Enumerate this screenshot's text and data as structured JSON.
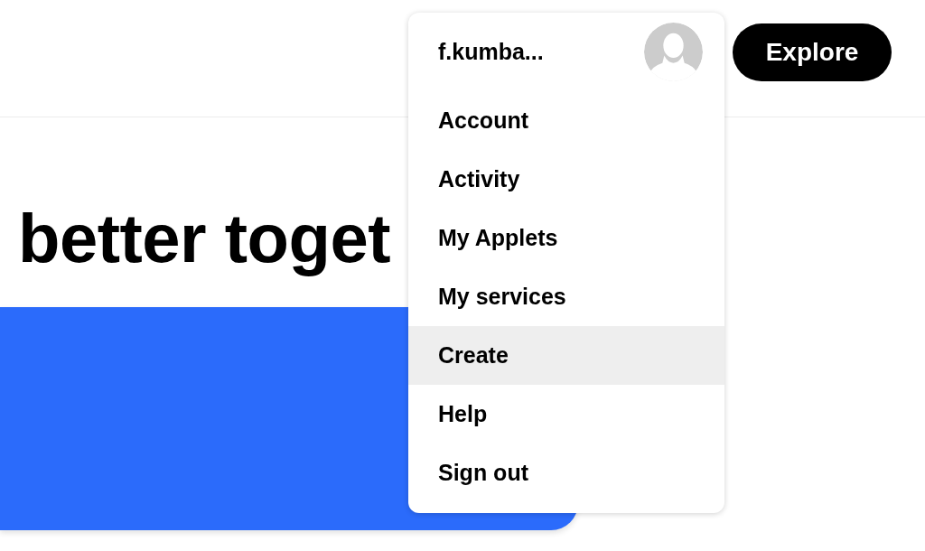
{
  "header": {
    "explore_button": "Explore"
  },
  "user_menu": {
    "username": "f.kumba...",
    "items": [
      {
        "label": "Account",
        "highlighted": false
      },
      {
        "label": "Activity",
        "highlighted": false
      },
      {
        "label": "My Applets",
        "highlighted": false
      },
      {
        "label": "My services",
        "highlighted": false
      },
      {
        "label": "Create",
        "highlighted": true
      },
      {
        "label": "Help",
        "highlighted": false
      },
      {
        "label": "Sign out",
        "highlighted": false
      }
    ]
  },
  "hero": {
    "heading": "better toget"
  }
}
